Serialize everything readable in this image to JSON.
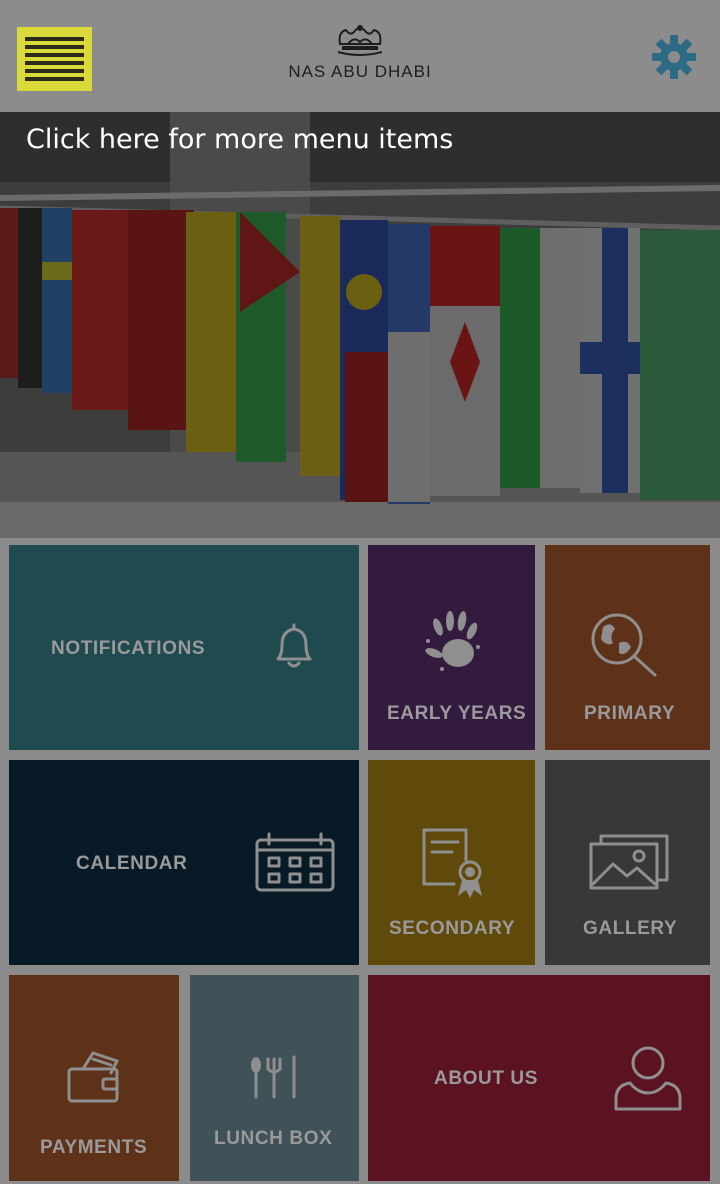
{
  "header": {
    "logo_text": "NAS ABU DHABI",
    "menu_icon": "hamburger-menu-icon",
    "settings_icon": "gear-icon",
    "colors": {
      "menu_button": "#d9d93a",
      "gear": "#2c6a86",
      "header_bg": "#8c8c8c"
    }
  },
  "hero": {
    "caption": "Click here for more menu items"
  },
  "tiles": {
    "notifications": {
      "label": "NOTIFICATIONS",
      "icon": "bell-icon",
      "color": "#1f4a4f"
    },
    "early_years": {
      "label": "EARLY YEARS",
      "icon": "handprint-icon",
      "color": "#331a3f"
    },
    "primary": {
      "label": "PRIMARY",
      "icon": "globe-magnifier-icon",
      "color": "#5e3219"
    },
    "calendar": {
      "label": "CALENDAR",
      "icon": "calendar-icon",
      "color": "#081a25"
    },
    "secondary": {
      "label": "SECONDARY",
      "icon": "certificate-icon",
      "color": "#5f4a0c"
    },
    "gallery": {
      "label": "GALLERY",
      "icon": "gallery-icon",
      "color": "#383838"
    },
    "payments": {
      "label": "PAYMENTS",
      "icon": "wallet-icon",
      "color": "#5e3219"
    },
    "lunch_box": {
      "label": "LUNCH BOX",
      "icon": "cutlery-icon",
      "color": "#3f5257"
    },
    "about_us": {
      "label": "ABOUT US",
      "icon": "user-icon",
      "color": "#5b1322"
    }
  }
}
